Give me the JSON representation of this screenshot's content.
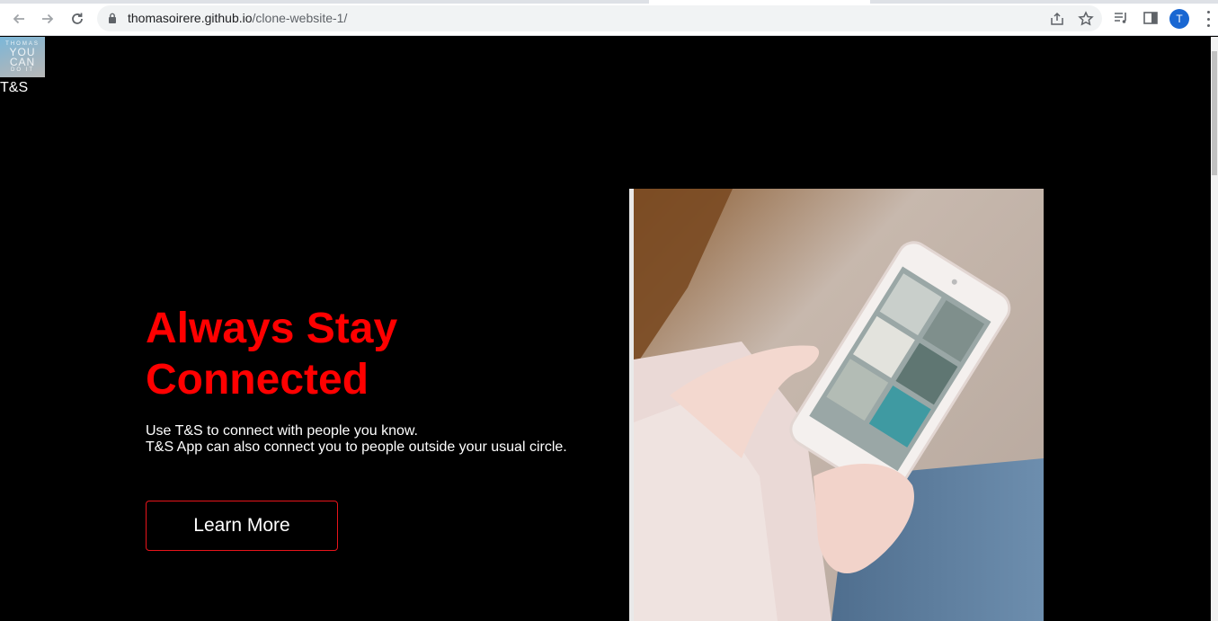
{
  "browser": {
    "url_host": "thomasoirere.github.io",
    "url_path": "/clone-website-1/",
    "profile_initial": "T"
  },
  "site": {
    "logo_lines": [
      "THOMAS",
      "YOU",
      "CAN",
      "DO IT"
    ],
    "brand": "T&S"
  },
  "hero": {
    "headline": "Always Stay Connected",
    "subtext_line1": "Use T&S to connect with people you know.",
    "subtext_line2": "T&S App can also connect you to people outside your usual circle.",
    "button_label": "Learn More"
  },
  "colors": {
    "background": "#000000",
    "headline": "#ff0000",
    "button_border": "#e8141b",
    "text": "#ffffff"
  },
  "icons": [
    "back-icon",
    "forward-icon",
    "reload-icon",
    "lock-icon",
    "share-icon",
    "bookmark-star-icon",
    "reading-list-icon",
    "side-panel-icon",
    "more-menu-icon"
  ]
}
